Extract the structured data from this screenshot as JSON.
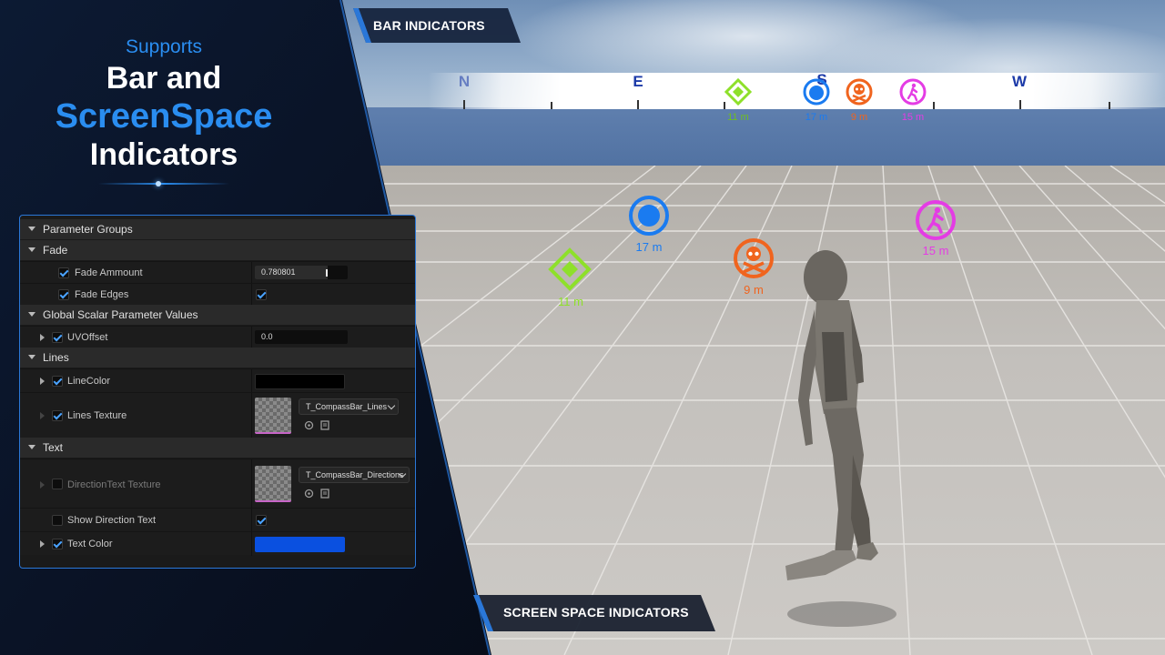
{
  "headline": {
    "line1": "Supports",
    "line2": "Bar and",
    "line3": "ScreenSpace",
    "line4": "Indicators"
  },
  "labels": {
    "bar_indicators": "BAR INDICATORS",
    "screen_space_indicators": "SCREEN SPACE INDICATORS"
  },
  "compass": {
    "letters": [
      "N",
      "E",
      "S",
      "W"
    ],
    "markers": [
      {
        "icon": "diamond-marker-icon",
        "color": "#8ee02a",
        "distance": "11 m"
      },
      {
        "icon": "bomb-circle-icon",
        "color": "#1a7bf0",
        "distance": "17 m"
      },
      {
        "icon": "skull-crossbones-icon",
        "color": "#f0641e",
        "distance": "9 m"
      },
      {
        "icon": "walking-person-icon",
        "color": "#e43ce4",
        "distance": "15 m"
      }
    ]
  },
  "world_indicators": [
    {
      "icon": "diamond-marker-icon",
      "color": "#8ee02a",
      "distance": "11 m"
    },
    {
      "icon": "bomb-circle-icon",
      "color": "#1a7bf0",
      "distance": "17 m"
    },
    {
      "icon": "skull-crossbones-icon",
      "color": "#f0641e",
      "distance": "9 m"
    },
    {
      "icon": "walking-person-icon",
      "color": "#e43ce4",
      "distance": "15 m"
    }
  ],
  "panel": {
    "parameter_groups": "Parameter Groups",
    "fade": {
      "title": "Fade",
      "fade_amount_label": "Fade Ammount",
      "fade_amount_value": "0.780801",
      "fade_amount_fraction": 0.78,
      "fade_edges_label": "Fade Edges"
    },
    "global_scalar": {
      "title": "Global Scalar Parameter Values",
      "uvoffset_label": "UVOffset",
      "uvoffset_value": "0.0"
    },
    "lines": {
      "title": "Lines",
      "line_color_label": "LineColor",
      "line_color": "#000000",
      "lines_texture_label": "Lines Texture",
      "lines_texture_value": "T_CompassBar_Lines"
    },
    "text": {
      "title": "Text",
      "direction_texture_label": "DirectionText Texture",
      "direction_texture_value": "T_CompassBar_Directions",
      "show_direction_label": "Show Direction Text",
      "text_color_label": "Text Color",
      "text_color": "#0a50e0"
    }
  },
  "colors": {
    "accent_blue": "#2a8df0",
    "panel_border": "#2a77d8",
    "dark_background": "#0b1322"
  }
}
